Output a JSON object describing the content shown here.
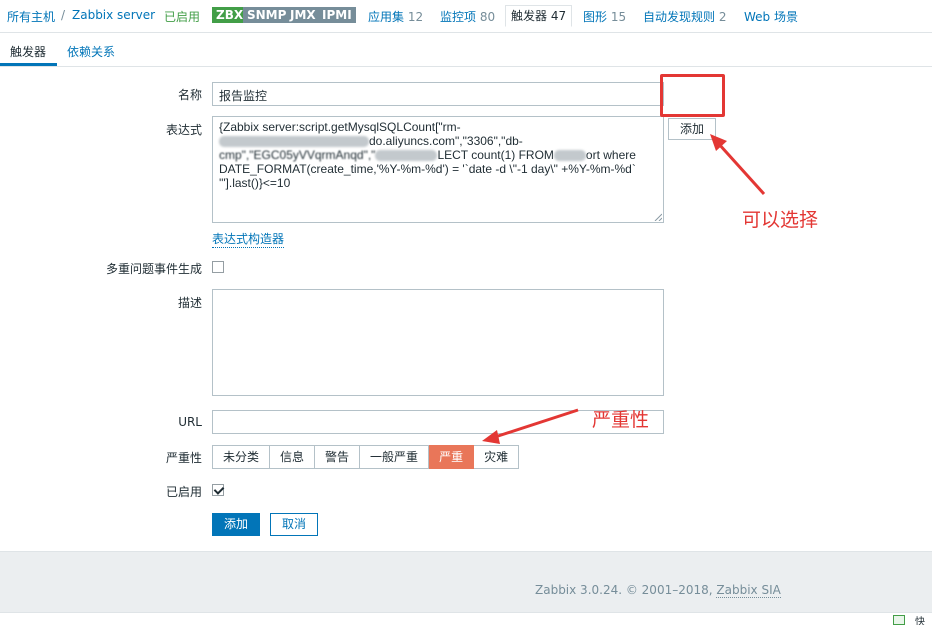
{
  "breadcrumb": {
    "all_hosts": "所有主机",
    "separator": "/",
    "host": "Zabbix server",
    "status": "已启用"
  },
  "availability": {
    "zbx": "ZBX",
    "snmp": "SNMP",
    "jmx": "JMX",
    "ipmi": "IPMI"
  },
  "host_tabs": [
    {
      "label": "应用集",
      "count": "12"
    },
    {
      "label": "监控项",
      "count": "80"
    },
    {
      "label": "触发器",
      "count": "47"
    },
    {
      "label": "图形",
      "count": "15"
    },
    {
      "label": "自动发现规则",
      "count": "2"
    },
    {
      "label": "Web 场景",
      "count": ""
    }
  ],
  "form_tabs": {
    "trigger": "触发器",
    "dependencies": "依赖关系"
  },
  "form": {
    "name_label": "名称",
    "name_value": "报告监控",
    "expression_label": "表达式",
    "expression_line1": "{Zabbix server:script.getMysqlSQLCount[\"rm-",
    "expression_seg_a": "do.aliyuncs.com\",\"3306\",\"db-",
    "expression_seg_b": "cmp\",\"EGC05yVVqrmAnqd\",\"",
    "expression_seg_c": "LECT count(1) FROM",
    "expression_seg_d": "ort where",
    "expression_line4": "DATE_FORMAT(create_time,'%Y-%m-%d') = '`date -d \\\"-1 day\\\" +%Y-%m-%d`",
    "expression_line5": "'\"].last()}<=10",
    "add_expression_button": "添加",
    "expression_builder_link": "表达式构造器",
    "multiple_events_label": "多重问题事件生成",
    "multiple_events_checked": false,
    "description_label": "描述",
    "description_value": "",
    "url_label": "URL",
    "url_value": "",
    "severity_label": "严重性",
    "severities": [
      "未分类",
      "信息",
      "警告",
      "一般严重",
      "严重",
      "灾难"
    ],
    "severity_selected": "严重",
    "enabled_label": "已启用",
    "enabled_checked": true,
    "submit_button": "添加",
    "cancel_button": "取消"
  },
  "annotations": {
    "add_note": "可以选择",
    "severity_note": "严重性"
  },
  "footer": {
    "version_text": "Zabbix 3.0.24. © 2001–2018,",
    "company_link": "Zabbix SIA"
  },
  "statusbar": {
    "text": "快"
  },
  "colors": {
    "accent_blue": "#0275b8",
    "enabled_green": "#429e47",
    "severity_high": "#e97659",
    "annotation_red": "#e33734"
  }
}
